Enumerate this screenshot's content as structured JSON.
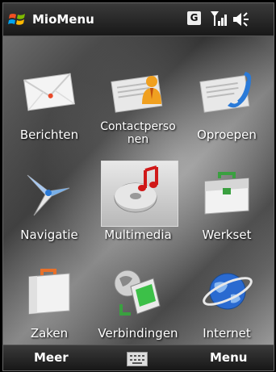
{
  "titlebar": {
    "title": "MioMenu",
    "status_g": "G"
  },
  "tiles": [
    {
      "label": "Berichten"
    },
    {
      "label": "Contactpersonen",
      "line1": "Contactperso",
      "line2": "nen"
    },
    {
      "label": "Oproepen"
    },
    {
      "label": "Navigatie"
    },
    {
      "label": "Multimedia"
    },
    {
      "label": "Werkset"
    },
    {
      "label": "Zaken"
    },
    {
      "label": "Verbindingen"
    },
    {
      "label": "Internet"
    }
  ],
  "softkeys": {
    "left": "Meer",
    "right": "Menu"
  },
  "colors": {
    "titlebar": "#1e1e1e",
    "accent_orange": "#f0a020",
    "accent_blue": "#2a7ad8",
    "selected_tile": "#d8d8d8"
  },
  "icons": [
    "windows-start-icon",
    "signal-strength-icon",
    "volume-icon",
    "envelope-icon",
    "contact-icon",
    "phone-icon",
    "navigation-icon",
    "multimedia-icon",
    "toolbox-icon",
    "briefcase-icon",
    "connections-icon",
    "internet-globe-icon",
    "keyboard-icon"
  ]
}
